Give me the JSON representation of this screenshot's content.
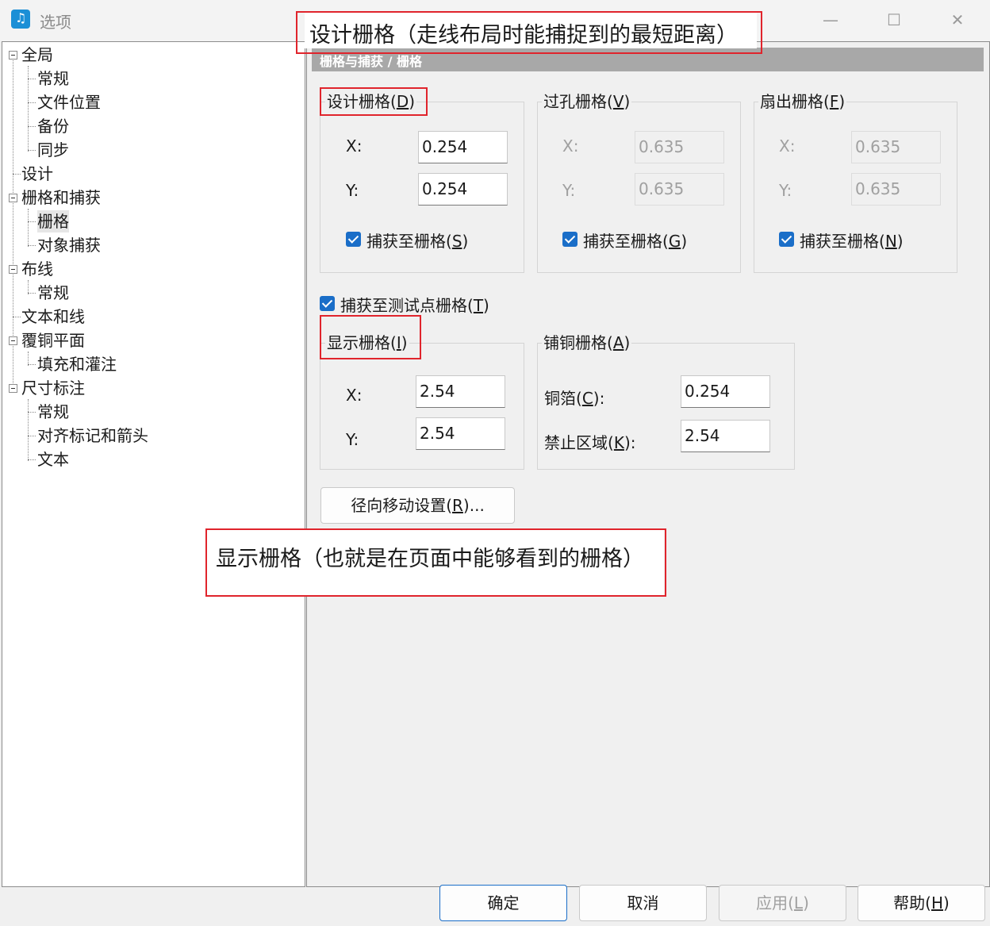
{
  "window": {
    "title": "选项",
    "controls": [
      "—",
      "☐",
      "✕"
    ]
  },
  "tree": [
    {
      "label": "全局"
    },
    {
      "label": "常规"
    },
    {
      "label": "文件位置"
    },
    {
      "label": "备份"
    },
    {
      "label": "同步"
    },
    {
      "label": "设计"
    },
    {
      "label": "栅格和捕获"
    },
    {
      "label": "栅格",
      "selected": true
    },
    {
      "label": "对象捕获"
    },
    {
      "label": "布线"
    },
    {
      "label": "常规"
    },
    {
      "label": "文本和线"
    },
    {
      "label": "覆铜平面"
    },
    {
      "label": "填充和灌注"
    },
    {
      "label": "尺寸标注"
    },
    {
      "label": "常规"
    },
    {
      "label": "对齐标记和箭头"
    },
    {
      "label": "文本"
    }
  ],
  "section_header": "栅格与捕获 / 栅格",
  "design_grid": {
    "label_text": "设计栅格(",
    "label_key": "D",
    "label_end": ")",
    "x_label": "X:",
    "x_value": "0.254",
    "y_label": "Y:",
    "y_value": "0.254",
    "snap_text": "捕获至栅格(",
    "snap_key": "S",
    "snap_end": ")"
  },
  "via_grid": {
    "label_text": "过孔栅格(",
    "label_key": "V",
    "label_end": ")",
    "x_label": "X:",
    "x_value": "0.635",
    "y_label": "Y:",
    "y_value": "0.635",
    "snap_text": "捕获至栅格(",
    "snap_key": "G",
    "snap_end": ")"
  },
  "fanout_grid": {
    "label_text": "扇出栅格(",
    "label_key": "F",
    "label_end": ")",
    "x_label": "X:",
    "x_value": "0.635",
    "y_label": "Y:",
    "y_value": "0.635",
    "snap_text": "捕获至栅格(",
    "snap_key": "N",
    "snap_end": ")"
  },
  "testpoint": {
    "text": "捕获至测试点栅格(",
    "key": "T",
    "end": ")"
  },
  "display_grid": {
    "label_text": "显示栅格(",
    "label_key": "I",
    "label_end": ")",
    "x_label": "X:",
    "x_value": "2.54",
    "y_label": "Y:",
    "y_value": "2.54"
  },
  "copper_grid": {
    "label_text": "铺铜栅格(",
    "label_key": "A",
    "label_end": ")",
    "copper_text": "铜箔(",
    "copper_key": "C",
    "copper_end": "):",
    "copper_value": "0.254",
    "keepout_text": "禁止区域(",
    "keepout_key": "K",
    "keepout_end": "):",
    "keepout_value": "2.54"
  },
  "radial_button": {
    "text": "径向移动设置(",
    "key": "R",
    "end": ")..."
  },
  "annotations": {
    "top": "设计栅格（走线布局时能捕捉到的最短距离）",
    "middle": "显示栅格（也就是在页面中能够看到的栅格）"
  },
  "footer": {
    "ok": "确定",
    "cancel": "取消",
    "apply_text": "应用(",
    "apply_key": "L",
    "apply_end": ")",
    "help_text": "帮助(",
    "help_key": "H",
    "help_end": ")"
  },
  "colors": {
    "accent": "#1a6ec8",
    "annotation_border": "#e0242c",
    "header_bg": "#a8a8a8"
  }
}
